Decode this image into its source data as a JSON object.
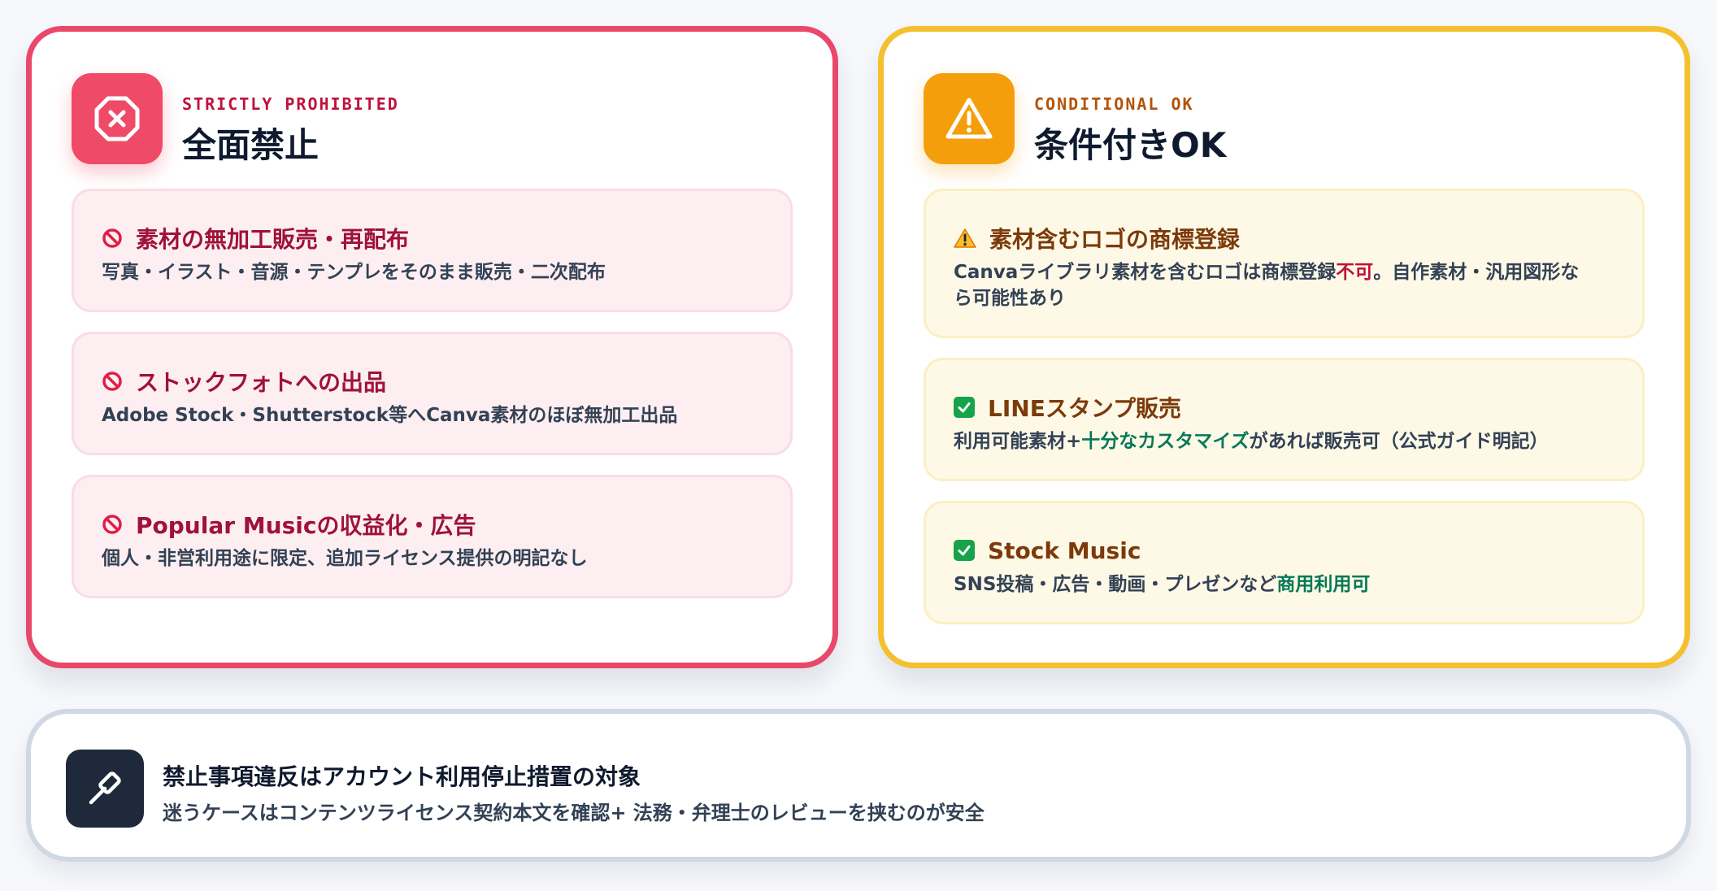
{
  "prohibited": {
    "eyebrow": "STRICTLY PROHIBITED",
    "title": "全面禁止",
    "icon": "octagon-x-icon",
    "items": [
      {
        "icon": "no-entry-icon",
        "title": "素材の無加工販売・再配布",
        "desc": "写真・イラスト・音源・テンプレをそのまま販売・二次配布"
      },
      {
        "icon": "no-entry-icon",
        "title": "ストックフォトへの出品",
        "desc": "Adobe Stock・Shutterstock等へCanva素材のほぼ無加工出品"
      },
      {
        "icon": "no-entry-icon",
        "title": "Popular Musicの収益化・広告",
        "desc": "個人・非営利用途に限定、追加ライセンス提供の明記なし"
      }
    ]
  },
  "conditional": {
    "eyebrow": "CONDITIONAL OK",
    "title": "条件付きOK",
    "icon": "warning-triangle-icon",
    "items": [
      {
        "icon": "warning-icon",
        "title": "素材含むロゴの商標登録",
        "desc_before": "Canvaライブラリ素材を含むロゴは商標登録",
        "desc_highlight": "不可",
        "desc_after_line1": "。自作素材・汎用図形な",
        "desc_line2": "ら可能性あり"
      },
      {
        "icon": "check-icon",
        "title": "LINEスタンプ販売",
        "desc_before": "利用可能素材+",
        "desc_highlight": "十分なカスタマイズ",
        "desc_after": "があれば販売可（公式ガイド明記）"
      },
      {
        "icon": "check-icon",
        "title": "Stock Music",
        "desc_before": "SNS投稿・広告・動画・プレゼンなど",
        "desc_highlight": "商用利用可"
      }
    ]
  },
  "footer": {
    "icon": "gavel-icon",
    "title": "禁止事項違反はアカウント利用停止措置の対象",
    "text": "迷うケースはコンテンツライセンス契約本文を確認+ 法務・弁理士のレビューを挟むのが安全"
  },
  "colors": {
    "prohibited_accent": "#e8486a",
    "conditional_accent": "#f5c02e",
    "highlight_red": "#be123c",
    "highlight_green": "#047857"
  }
}
